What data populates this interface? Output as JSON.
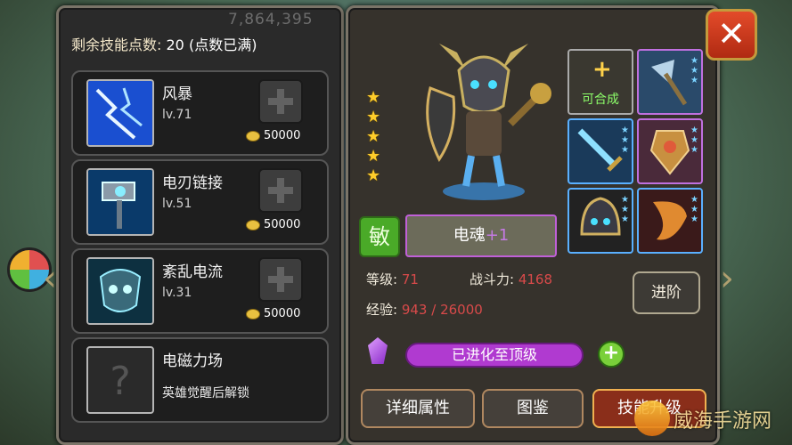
{
  "left_panel": {
    "faint_background_text": "7,864,395",
    "points_label": "剩余技能点数:",
    "points_value": "20 (点数已满)"
  },
  "skills": [
    {
      "name": "风暴",
      "level": "lv.71",
      "cost": "50000"
    },
    {
      "name": "电刃链接",
      "level": "lv.51",
      "cost": "50000"
    },
    {
      "name": "紊乱电流",
      "level": "lv.31",
      "cost": "50000"
    },
    {
      "name": "电磁力场",
      "lock_text": "英雄觉醒后解锁"
    }
  ],
  "hero": {
    "star_count": 5,
    "class_badge": "敏",
    "name": "电魂",
    "name_bonus": "+1",
    "stats": {
      "level_label": "等级:",
      "level_value": "71",
      "power_label": "战斗力:",
      "power_value": "4168",
      "exp_label": "经验:",
      "exp_value": "943 / 26000"
    },
    "advance_button": "进阶",
    "evolve_status": "已进化至顶级"
  },
  "equipment": [
    {
      "name": "craftable-slot",
      "label": "可合成"
    },
    {
      "name": "axe",
      "stars": 3
    },
    {
      "name": "sword",
      "stars": 3
    },
    {
      "name": "shield",
      "stars": 3
    },
    {
      "name": "helmet",
      "stars": 3
    },
    {
      "name": "cloak",
      "stars": 3
    }
  ],
  "tabs": {
    "details": "详细属性",
    "codex": "图鉴",
    "skill_upgrade": "技能升级"
  },
  "close_button": "✕",
  "watermark": "威海手游网",
  "colors": {
    "evolve_bar": "#b03ad0",
    "stat_value": "#d84a4a",
    "active_tab": "#8a2e1a"
  }
}
